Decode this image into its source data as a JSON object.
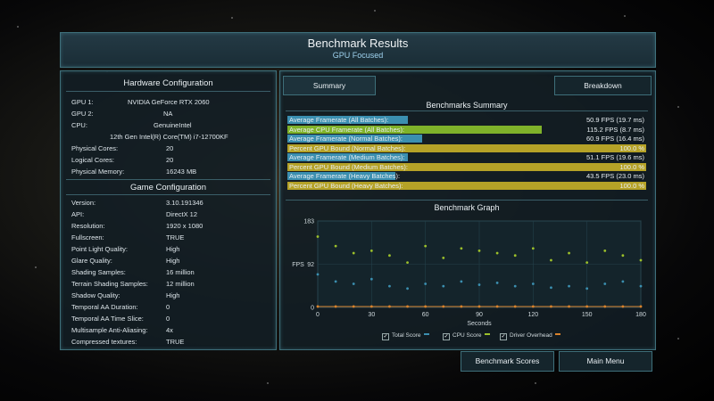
{
  "header": {
    "title": "Benchmark Results",
    "subtitle": "GPU Focused"
  },
  "hardware": {
    "title": "Hardware Configuration",
    "rows": [
      {
        "label": "GPU 1:",
        "value": "NVIDIA GeForce RTX 2060"
      },
      {
        "label": "GPU 2:",
        "value": "NA"
      },
      {
        "label": "CPU:",
        "value": "GenuineIntel"
      },
      {
        "label": "",
        "value": "12th Gen Intel(R) Core(TM) i7-12700KF"
      },
      {
        "label": "Physical Cores:",
        "value": "20"
      },
      {
        "label": "Logical Cores:",
        "value": "20"
      },
      {
        "label": "Physical Memory:",
        "value": "16243  MB"
      }
    ]
  },
  "game": {
    "title": "Game Configuration",
    "rows": [
      {
        "label": "Version:",
        "value": "3.10.191346"
      },
      {
        "label": "API:",
        "value": "DirectX 12"
      },
      {
        "label": "Resolution:",
        "value": "1920 x 1080"
      },
      {
        "label": "Fullscreen:",
        "value": "TRUE"
      },
      {
        "label": "Point Light Quality:",
        "value": "High"
      },
      {
        "label": "Glare Quality:",
        "value": "High"
      },
      {
        "label": "Shading Samples:",
        "value": "16 million"
      },
      {
        "label": "Terrain Shading Samples:",
        "value": "12 million"
      },
      {
        "label": "Shadow Quality:",
        "value": "High"
      },
      {
        "label": "Temporal AA Duration:",
        "value": "0"
      },
      {
        "label": "Temporal AA Time Slice:",
        "value": "0"
      },
      {
        "label": "Multisample Anti-Aliasing:",
        "value": "4x"
      },
      {
        "label": "Compressed textures:",
        "value": "TRUE"
      }
    ]
  },
  "tabs": {
    "summary": "Summary",
    "breakdown": "Breakdown"
  },
  "summary": {
    "title": "Benchmarks Summary",
    "rows": [
      {
        "label": "Average Framerate (All Batches):",
        "value": "50.9 FPS (19.7 ms)",
        "fill": 0.335,
        "color": "#3b8fb0"
      },
      {
        "label": "Average CPU Framerate (All Batches):",
        "value": "115.2 FPS (8.7 ms)",
        "fill": 0.71,
        "color": "#7fb22a"
      },
      {
        "label": "Average Framerate (Normal Batches):",
        "value": "60.9 FPS (16.4 ms)",
        "fill": 0.375,
        "color": "#3b8fb0"
      },
      {
        "label": "Percent GPU Bound (Normal Batches):",
        "value": "100.0 %",
        "fill": 1.0,
        "color": "#b5a227"
      },
      {
        "label": "Average Framerate (Medium Batches):",
        "value": "51.1 FPS (19.6 ms)",
        "fill": 0.335,
        "color": "#3b8fb0"
      },
      {
        "label": "Percent GPU Bound (Medium Batches):",
        "value": "100.0 %",
        "fill": 1.0,
        "color": "#b5a227"
      },
      {
        "label": "Average Framerate (Heavy Batches):",
        "value": "43.5 FPS (23.0 ms)",
        "fill": 0.3,
        "color": "#3b8fb0"
      },
      {
        "label": "Percent GPU Bound (Heavy Batches):",
        "value": "100.0 %",
        "fill": 1.0,
        "color": "#b5a227"
      }
    ]
  },
  "graph": {
    "title": "Benchmark Graph",
    "ylabel": "FPS",
    "xlabel": "Seconds",
    "yticks": [
      "183",
      "92",
      "0"
    ],
    "xticks": [
      "0",
      "30",
      "60",
      "90",
      "120",
      "150",
      "180"
    ],
    "legend": [
      {
        "label": "Total Score",
        "color": "#3b8fb0"
      },
      {
        "label": "CPU Score",
        "color": "#9cc02a"
      },
      {
        "label": "Driver Overhead",
        "color": "#d9822b"
      }
    ]
  },
  "chart_data": {
    "type": "scatter",
    "title": "Benchmark Graph",
    "xlabel": "Seconds",
    "ylabel": "FPS",
    "xlim": [
      0,
      180
    ],
    "ylim": [
      0,
      183
    ],
    "series": [
      {
        "name": "Total Score",
        "x": [
          0,
          10,
          20,
          30,
          40,
          50,
          60,
          70,
          80,
          90,
          100,
          110,
          120,
          130,
          140,
          150,
          160,
          170,
          180
        ],
        "values": [
          70,
          55,
          50,
          60,
          45,
          40,
          50,
          45,
          55,
          48,
          52,
          45,
          50,
          42,
          45,
          40,
          50,
          55,
          45
        ]
      },
      {
        "name": "CPU Score",
        "x": [
          0,
          10,
          20,
          30,
          40,
          50,
          60,
          70,
          80,
          90,
          100,
          110,
          120,
          130,
          140,
          150,
          160,
          170,
          180
        ],
        "values": [
          150,
          130,
          115,
          120,
          110,
          95,
          130,
          105,
          125,
          120,
          115,
          110,
          125,
          100,
          115,
          95,
          120,
          110,
          100
        ]
      },
      {
        "name": "Driver Overhead",
        "x": [
          0,
          10,
          20,
          30,
          40,
          50,
          60,
          70,
          80,
          90,
          100,
          110,
          120,
          130,
          140,
          150,
          160,
          170,
          180
        ],
        "values": [
          2,
          2,
          2,
          2,
          2,
          2,
          2,
          2,
          2,
          2,
          2,
          2,
          2,
          2,
          2,
          2,
          2,
          2,
          2
        ]
      }
    ]
  },
  "buttons": {
    "scores": "Benchmark Scores",
    "menu": "Main Menu"
  }
}
